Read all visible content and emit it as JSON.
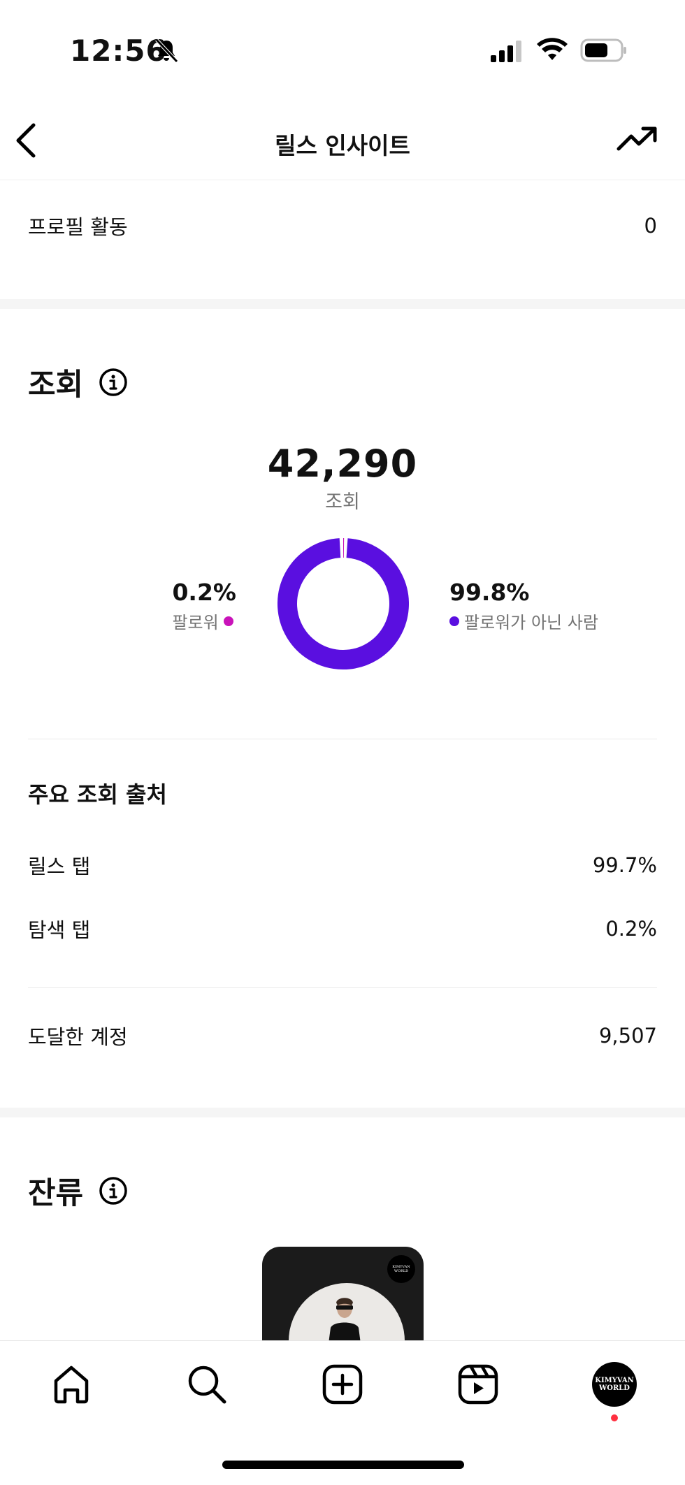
{
  "status_bar": {
    "time": "12:56"
  },
  "header": {
    "title": "릴스 인사이트"
  },
  "profile_activity": {
    "label": "프로필 활동",
    "value": "0"
  },
  "views": {
    "title": "조회",
    "total": "42,290",
    "total_label": "조회",
    "followers_pct": "0.2%",
    "followers_label": "팔로워",
    "non_followers_pct": "99.8%",
    "non_followers_label": "팔로워가 아닌 사람",
    "follower_fraction": 0.002,
    "colors": {
      "followers": "#c913b9",
      "non_followers": "#5a0fe0"
    },
    "sources_title": "주요 조회 출처",
    "sources": [
      {
        "label": "릴스 탭",
        "value": "99.7%"
      },
      {
        "label": "탐색 탭",
        "value": "0.2%"
      }
    ],
    "reached": {
      "label": "도달한 계정",
      "value": "9,507"
    }
  },
  "retention": {
    "title": "잔류",
    "thumb_badge": "KIMYVAN WORLD"
  },
  "tabbar": {
    "icons": [
      "home-icon",
      "search-icon",
      "create-icon",
      "reels-icon"
    ],
    "avatar_text": "KIMYVAN WORLD",
    "notification_color": "#ff3040"
  }
}
